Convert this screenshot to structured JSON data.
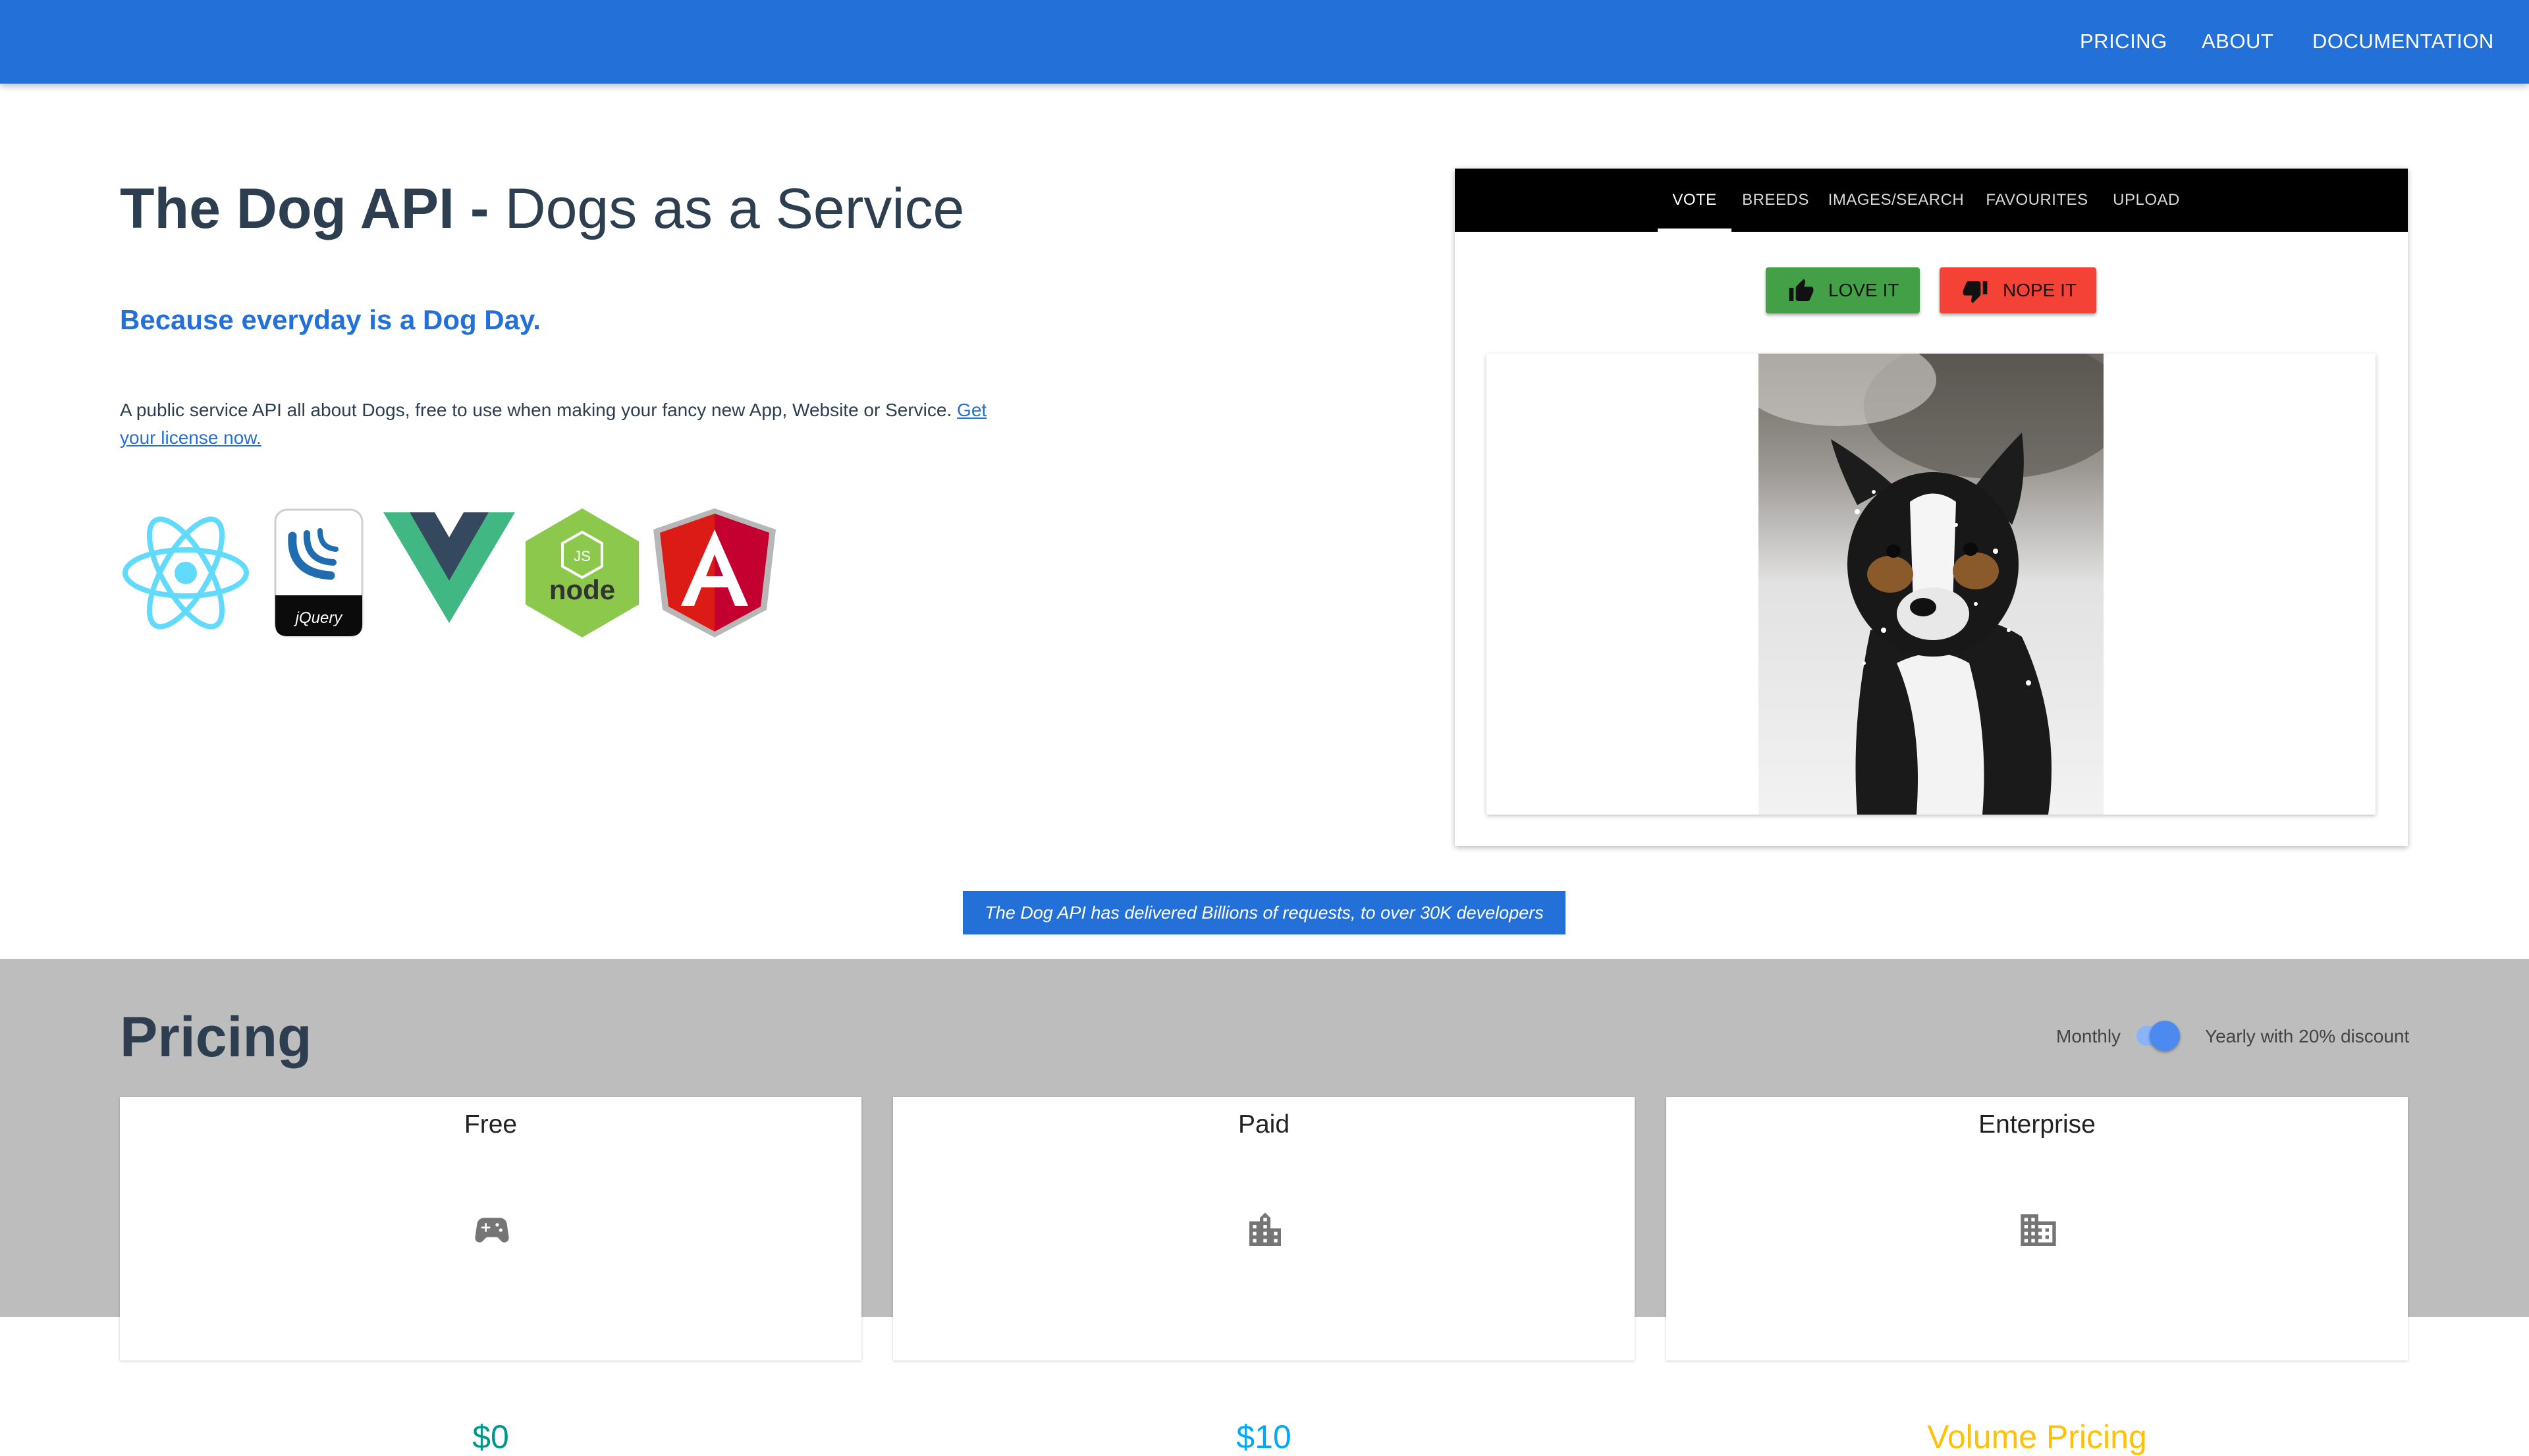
{
  "nav": {
    "links": [
      "PRICING",
      "ABOUT",
      "DOCUMENTATION"
    ]
  },
  "hero": {
    "title_bold": "The Dog API -",
    "title_rest": "Dogs as a Service",
    "tagline": "Because everyday is a Dog Day.",
    "description": "A public service API all about Dogs, free to use when making your fancy new App, Website or Service.",
    "license_link": "Get your license now.",
    "logos": [
      "react-logo",
      "jquery-logo",
      "vue-logo",
      "node-logo",
      "angular-logo"
    ]
  },
  "widget": {
    "tabs": [
      "VOTE",
      "BREEDS",
      "IMAGES/SEARCH",
      "FAVOURITES",
      "UPLOAD"
    ],
    "active_tab": "VOTE",
    "love_label": "LOVE IT",
    "nope_label": "NOPE IT",
    "image_subject": "dog-photo"
  },
  "stats_banner": "The Dog API has delivered Billions of requests, to over 30K developers",
  "pricing": {
    "title": "Pricing",
    "billing_monthly": "Monthly",
    "billing_yearly": "Yearly with 20% discount",
    "plans": [
      {
        "name": "Free",
        "icon": "gamepad-icon",
        "price": "$0",
        "color": "#009688"
      },
      {
        "name": "Paid",
        "icon": "building-icon",
        "price": "$10",
        "color": "#03a9f4"
      },
      {
        "name": "Enterprise",
        "icon": "city-building-icon",
        "price": "Volume Pricing",
        "color": "#ffc107"
      }
    ]
  },
  "colors": {
    "primary": "#2370d8",
    "love_button": "#43a047",
    "nope_button": "#f44336",
    "pricing_background": "#bdbdbd"
  }
}
